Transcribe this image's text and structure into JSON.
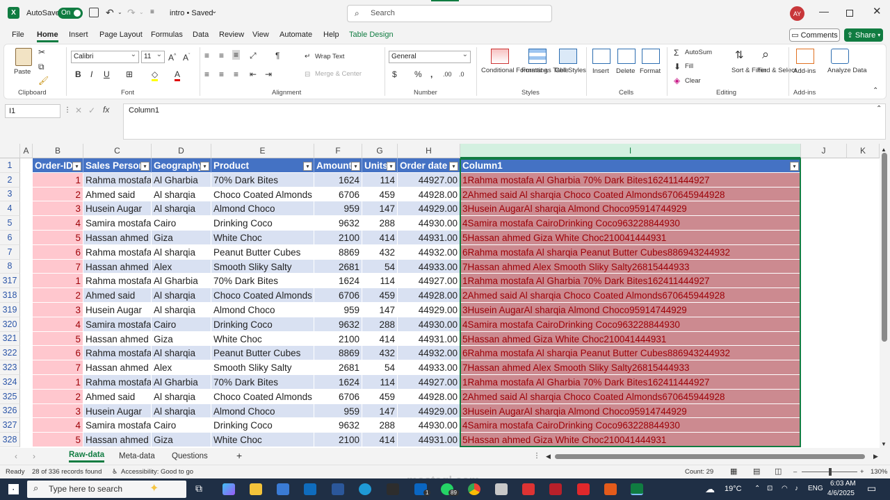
{
  "titlebar": {
    "autosave_label": "AutoSave",
    "autosave_state": "On",
    "file_name": "intro • Saved",
    "search_placeholder": "Search",
    "user_initials": "AY"
  },
  "menu": [
    "File",
    "Home",
    "Insert",
    "Page Layout",
    "Formulas",
    "Data",
    "Review",
    "View",
    "Automate",
    "Help",
    "Table Design"
  ],
  "buttons": {
    "comments": "Comments",
    "share": "Share"
  },
  "ribbon": {
    "clipboard": {
      "paste": "Paste",
      "label": "Clipboard"
    },
    "font": {
      "family": "Calibri",
      "size": "11",
      "label": "Font"
    },
    "alignment": {
      "wrap": "Wrap Text",
      "merge": "Merge & Center",
      "label": "Alignment"
    },
    "number": {
      "format": "General",
      "label": "Number"
    },
    "styles": {
      "conditional": "Conditional Formatting",
      "format_table": "Format as Table",
      "cell_styles": "Cell Styles",
      "label": "Styles"
    },
    "cells": {
      "insert": "Insert",
      "delete": "Delete",
      "format": "Format",
      "label": "Cells"
    },
    "editing": {
      "autosum": "AutoSum",
      "fill": "Fill",
      "clear": "Clear",
      "sort": "Sort & Filter",
      "find": "Find & Select",
      "label": "Editing"
    },
    "addins": {
      "addins": "Add-ins",
      "label": "Add-ins",
      "analyze": "Analyze Data"
    }
  },
  "formula_bar": {
    "name_box": "I1",
    "fx": "fx",
    "content": "Column1"
  },
  "columns": [
    "A",
    "B",
    "C",
    "D",
    "E",
    "F",
    "G",
    "H",
    "I",
    "J",
    "K"
  ],
  "table": {
    "headers": [
      "Order-ID",
      "Sales Person",
      "Geography",
      "Product",
      "Amount",
      "Units",
      "Order date",
      "Column1"
    ],
    "rows": [
      {
        "row": "2",
        "cells": [
          "1",
          "Rahma mostafa",
          "Al Gharbia",
          "70% Dark Bites",
          "1624",
          "114",
          "44927.00",
          "1Rahma mostafa Al Gharbia 70% Dark Bites162411444927"
        ]
      },
      {
        "row": "3",
        "cells": [
          "2",
          "Ahmed said",
          "Al sharqia",
          "Choco Coated Almonds",
          "6706",
          "459",
          "44928.00",
          "2Ahmed said Al sharqia Choco Coated Almonds670645944928"
        ]
      },
      {
        "row": "4",
        "cells": [
          "3",
          "Husein Augar",
          "Al sharqia",
          "Almond Choco",
          "959",
          "147",
          "44929.00",
          "3Husein AugarAl sharqia Almond Choco95914744929"
        ]
      },
      {
        "row": "5",
        "cells": [
          "4",
          "Samira mostafa",
          "Cairo",
          "Drinking Coco",
          "9632",
          "288",
          "44930.00",
          "4Samira mostafa CairoDrinking Coco963228844930"
        ]
      },
      {
        "row": "6",
        "cells": [
          "5",
          "Hassan ahmed",
          "Giza",
          "White Choc",
          "2100",
          "414",
          "44931.00",
          "5Hassan ahmed Giza White Choc210041444931"
        ]
      },
      {
        "row": "7",
        "cells": [
          "6",
          "Rahma mostafa",
          "Al sharqia",
          "Peanut Butter Cubes",
          "8869",
          "432",
          "44932.00",
          "6Rahma mostafa Al sharqia Peanut Butter Cubes886943244932"
        ]
      },
      {
        "row": "8",
        "cells": [
          "7",
          "Hassan ahmed",
          "Alex",
          "Smooth Sliky Salty",
          "2681",
          "54",
          "44933.00",
          "7Hassan ahmed Alex Smooth Sliky Salty26815444933"
        ]
      },
      {
        "row": "317",
        "cells": [
          "1",
          "Rahma mostafa",
          "Al Gharbia",
          "70% Dark Bites",
          "1624",
          "114",
          "44927.00",
          "1Rahma mostafa Al Gharbia 70% Dark Bites162411444927"
        ]
      },
      {
        "row": "318",
        "cells": [
          "2",
          "Ahmed said",
          "Al sharqia",
          "Choco Coated Almonds",
          "6706",
          "459",
          "44928.00",
          "2Ahmed said Al sharqia Choco Coated Almonds670645944928"
        ]
      },
      {
        "row": "319",
        "cells": [
          "3",
          "Husein Augar",
          "Al sharqia",
          "Almond Choco",
          "959",
          "147",
          "44929.00",
          "3Husein AugarAl sharqia Almond Choco95914744929"
        ]
      },
      {
        "row": "320",
        "cells": [
          "4",
          "Samira mostafa",
          "Cairo",
          "Drinking Coco",
          "9632",
          "288",
          "44930.00",
          "4Samira mostafa CairoDrinking Coco963228844930"
        ]
      },
      {
        "row": "321",
        "cells": [
          "5",
          "Hassan ahmed",
          "Giza",
          "White Choc",
          "2100",
          "414",
          "44931.00",
          "5Hassan ahmed Giza White Choc210041444931"
        ]
      },
      {
        "row": "322",
        "cells": [
          "6",
          "Rahma mostafa",
          "Al sharqia",
          "Peanut Butter Cubes",
          "8869",
          "432",
          "44932.00",
          "6Rahma mostafa Al sharqia Peanut Butter Cubes886943244932"
        ]
      },
      {
        "row": "323",
        "cells": [
          "7",
          "Hassan ahmed",
          "Alex",
          "Smooth Sliky Salty",
          "2681",
          "54",
          "44933.00",
          "7Hassan ahmed Alex Smooth Sliky Salty26815444933"
        ]
      },
      {
        "row": "324",
        "cells": [
          "1",
          "Rahma mostafa",
          "Al Gharbia",
          "70% Dark Bites",
          "1624",
          "114",
          "44927.00",
          "1Rahma mostafa Al Gharbia 70% Dark Bites162411444927"
        ]
      },
      {
        "row": "325",
        "cells": [
          "2",
          "Ahmed said",
          "Al sharqia",
          "Choco Coated Almonds",
          "6706",
          "459",
          "44928.00",
          "2Ahmed said Al sharqia Choco Coated Almonds670645944928"
        ]
      },
      {
        "row": "326",
        "cells": [
          "3",
          "Husein Augar",
          "Al sharqia",
          "Almond Choco",
          "959",
          "147",
          "44929.00",
          "3Husein AugarAl sharqia Almond Choco95914744929"
        ]
      },
      {
        "row": "327",
        "cells": [
          "4",
          "Samira mostafa",
          "Cairo",
          "Drinking Coco",
          "9632",
          "288",
          "44930.00",
          "4Samira mostafa CairoDrinking Coco963228844930"
        ]
      },
      {
        "row": "328",
        "cells": [
          "5",
          "Hassan ahmed",
          "Giza",
          "White Choc",
          "2100",
          "414",
          "44931.00",
          "5Hassan ahmed Giza White Choc210041444931"
        ]
      }
    ]
  },
  "sheets": [
    "Raw-data",
    "Meta-data",
    "Questions"
  ],
  "status": {
    "ready": "Ready",
    "records": "28 of 336 records found",
    "accessibility": "Accessibility: Good to go",
    "count": "Count: 29",
    "zoom": "130%"
  },
  "taskbar": {
    "search": "Type here to search",
    "weather": "19°C",
    "lang": "ENG",
    "time": "6:03 AM",
    "date": "4/6/2025",
    "badge_linkedin": "1",
    "badge_whatsapp": "89"
  },
  "watermark": {
    "text": "mostaql.com"
  },
  "colors": {
    "excel_green": "#107c41",
    "table_header": "#4472c4",
    "band": "#d9e1f2",
    "bad_fill": "#ffc7ce",
    "bad_text": "#9c0006"
  }
}
